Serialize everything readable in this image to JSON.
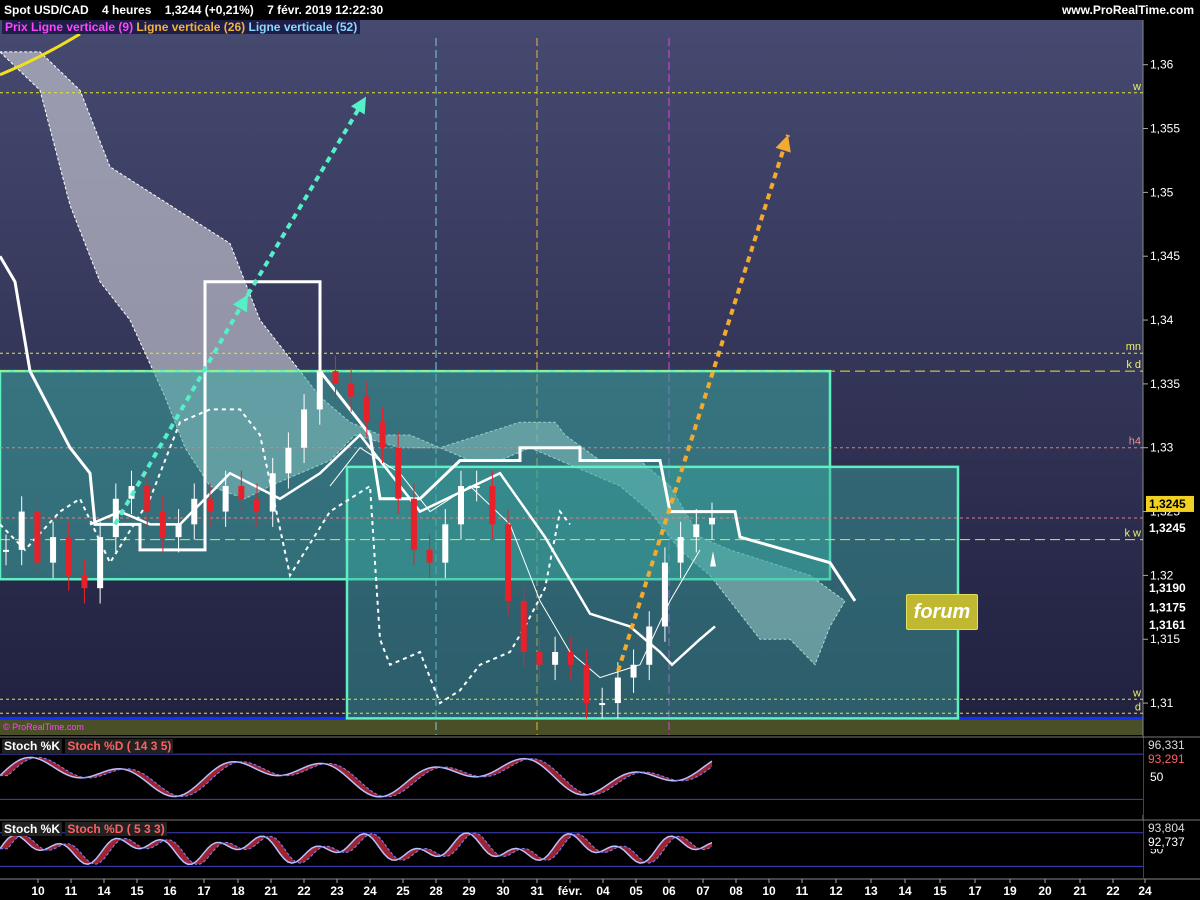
{
  "header": {
    "instrument": "Spot USD/CAD",
    "timeframe": "4 heures",
    "last": "1,3244 (+0,21%)",
    "datetime": "7 févr. 2019 12:22:30",
    "brand": "www.ProRealTime.com",
    "copyright": "© ProRealTime.com"
  },
  "legend": [
    {
      "text": "Prix",
      "color": "#ff44ff",
      "bg": "#2a2a6a"
    },
    {
      "text": "Ligne verticale (9)",
      "color": "#ff44ff",
      "bg": "#2a2a6a"
    },
    {
      "text": "Ligne verticale (26)",
      "color": "#f2b23a",
      "bg": "#2a2a6a"
    },
    {
      "text": "Ligne verticale (52)",
      "color": "#8ad6ff",
      "bg": "#2a2a6a"
    }
  ],
  "colors": {
    "background_top": "#464a70",
    "background_bottom": "#20203f",
    "lower_band": "#4a4f28",
    "box_border": "#5ff0c0",
    "box_fill": "#3aa8a0",
    "up_candle": "#ffffff",
    "down_candle": "#e8202a",
    "cloud": "#d4d4dc",
    "arrow_teal": "#55f0c8",
    "arrow_orange": "#f2aa30",
    "yellow_dash": "#e6e632",
    "stoch_main": "#b8c0ff",
    "stoch_signal": "#ff5050",
    "axis_label": "#ffffff"
  },
  "annotations": {
    "forum": "forum"
  },
  "level_labels": {
    "w_top": "w",
    "mn": "mn",
    "kd": "k d",
    "h4": "h4",
    "kw": "k w",
    "w_low": "w",
    "d_low": "d"
  },
  "price_labels": {
    "current": "1,3245",
    "current_dup": "1,3245",
    "p1": "1,3190",
    "p2": "1,3175",
    "p3": "1,3161"
  },
  "stoch1": {
    "label_k": "Stoch %K",
    "label_d": "Stoch %D ( 14 3 5)",
    "v1": "96,331",
    "v2": "93,291",
    "tick": "50"
  },
  "stoch2": {
    "label_k": "Stoch %K",
    "label_d": "Stoch %D ( 5 3 3)",
    "v1": "93,804",
    "v2": "92,737",
    "tick": "50"
  },
  "chart_data": {
    "type": "candlestick",
    "title": "Spot USD/CAD",
    "timeframe": "4 heures",
    "ylim": [
      1.3075,
      1.3635
    ],
    "y_ticks": [
      "1,36",
      "1,355",
      "1,35",
      "1,345",
      "1,34",
      "1,335",
      "1,33",
      "1,325",
      "1,32",
      "1,315",
      "1,31"
    ],
    "x_ticks": [
      "10",
      "11",
      "14",
      "15",
      "16",
      "17",
      "18",
      "21",
      "22",
      "23",
      "24",
      "25",
      "28",
      "29",
      "30",
      "31",
      "févr.",
      "04",
      "05",
      "06",
      "07",
      "08",
      "10",
      "11",
      "12",
      "13",
      "14",
      "15",
      "17",
      "19",
      "20",
      "21",
      "22",
      "24"
    ],
    "horizontal_levels": [
      {
        "name": "w",
        "value": 1.3578
      },
      {
        "name": "mn",
        "value": 1.3374
      },
      {
        "name": "k d",
        "value": 1.336
      },
      {
        "name": "h4",
        "value": 1.33
      },
      {
        "name": "current",
        "value": 1.3245
      },
      {
        "name": "k w",
        "value": 1.3228
      },
      {
        "name": "w",
        "value": 1.3103
      },
      {
        "name": "d",
        "value": 1.3092
      }
    ],
    "vertical_lines": [
      {
        "name": "Ligne verticale (52)",
        "x": "28"
      },
      {
        "name": "Ligne verticale (26)",
        "x": "31"
      },
      {
        "name": "Ligne verticale (9)",
        "x": "06"
      }
    ],
    "boxes": [
      {
        "x_from": "10",
        "x_to": "13",
        "y_from": 1.3197,
        "y_to": 1.336
      },
      {
        "x_from": "23",
        "x_to": "18",
        "y_from": 1.3088,
        "y_to": 1.3285
      }
    ],
    "candles_sampled": [
      1.322,
      1.325,
      1.321,
      1.323,
      1.32,
      1.319,
      1.323,
      1.326,
      1.327,
      1.325,
      1.323,
      1.324,
      1.326,
      1.325,
      1.327,
      1.326,
      1.325,
      1.328,
      1.33,
      1.333,
      1.336,
      1.335,
      1.334,
      1.332,
      1.33,
      1.326,
      1.322,
      1.321,
      1.324,
      1.327,
      1.327,
      1.324,
      1.318,
      1.314,
      1.313,
      1.314,
      1.313,
      1.31,
      1.31,
      1.312,
      1.313,
      1.316,
      1.321,
      1.323,
      1.324,
      1.3245
    ],
    "stoch_14_3_5": {
      "k_last": 96.331,
      "d_last": 93.291
    },
    "stoch_5_3_3": {
      "k_last": 93.804,
      "d_last": 92.737
    }
  }
}
